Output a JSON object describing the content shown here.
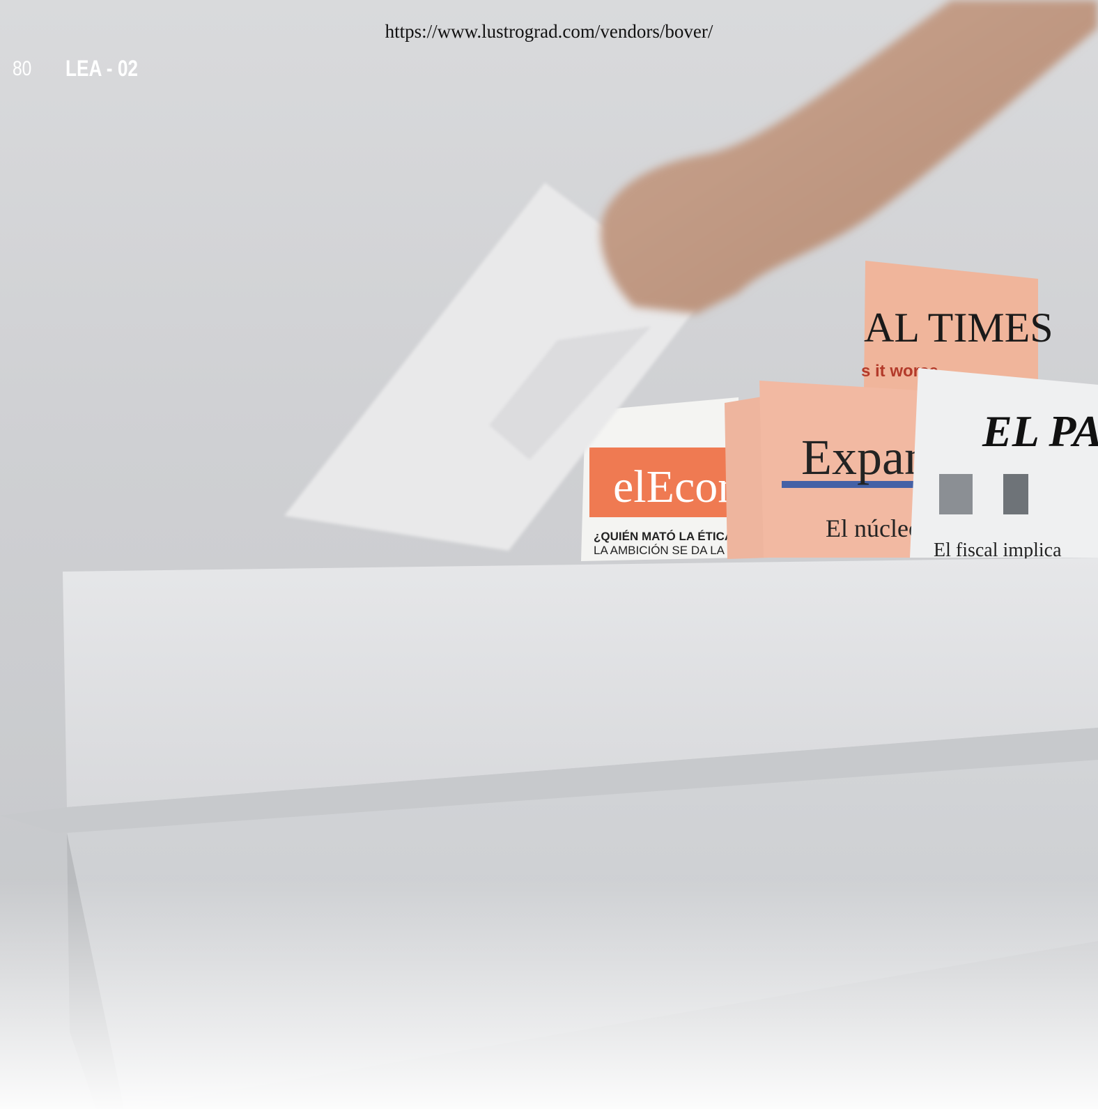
{
  "header": {
    "url": "https://www.lustrograd.com/vendors/bover/",
    "page_number": "80",
    "title": "LEA - 02"
  },
  "photo": {
    "newspapers": {
      "ft_headline": "AL TIMES",
      "ft_subline": "s it worse",
      "economista": {
        "masthead": "elEcon",
        "line1": "¿QUIÉN MATÓ LA ÉTICA FINANC",
        "line2": "LA AMBICIÓN SE DA LA MANO C"
      },
      "expansion": {
        "masthead": "Expan",
        "headline": "El núcleo du"
      },
      "el_pais": {
        "masthead": "EL PAÍS",
        "headline": "El fiscal implica"
      }
    },
    "colors": {
      "wall": "#d6d7d9",
      "shelf": "#dfe0e2",
      "salmon": "#f0b59b",
      "economista_red": "#ef7a52",
      "expansion_blue": "#4561a6"
    }
  }
}
